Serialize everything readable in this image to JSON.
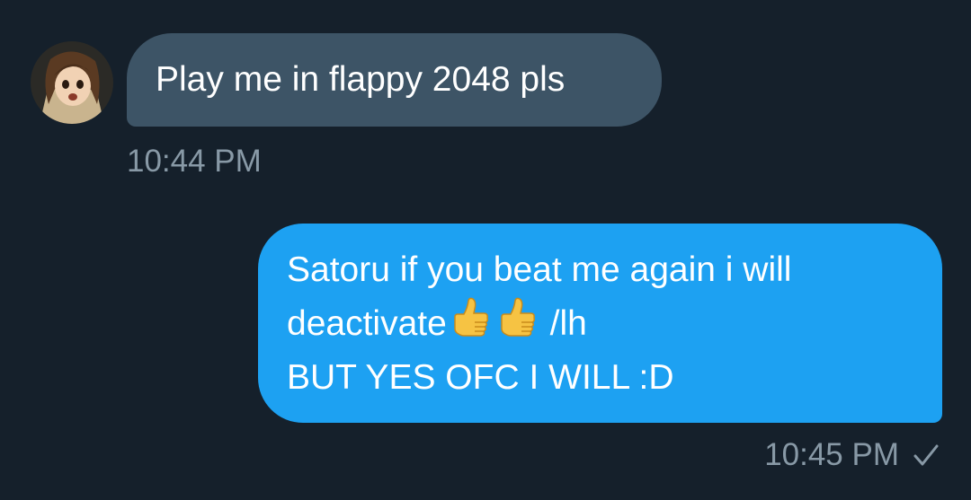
{
  "conversation": {
    "incoming": {
      "text": "Play me in flappy 2048 pls",
      "timestamp": "10:44 PM",
      "avatar": "anime-girl-avatar"
    },
    "outgoing": {
      "line1": "Satoru if you beat me again i will",
      "line2_prefix": "deactivate",
      "line2_suffix": " /lh",
      "line3": "BUT YES OFC I WILL :D",
      "emoji": [
        "thumbs-up",
        "thumbs-up"
      ],
      "timestamp": "10:45 PM",
      "status_icon": "check-icon"
    }
  },
  "colors": {
    "background": "#15202b",
    "incoming_bubble": "#3d5466",
    "outgoing_bubble": "#1da1f2",
    "timestamp": "#8899a6",
    "text": "#ffffff"
  }
}
